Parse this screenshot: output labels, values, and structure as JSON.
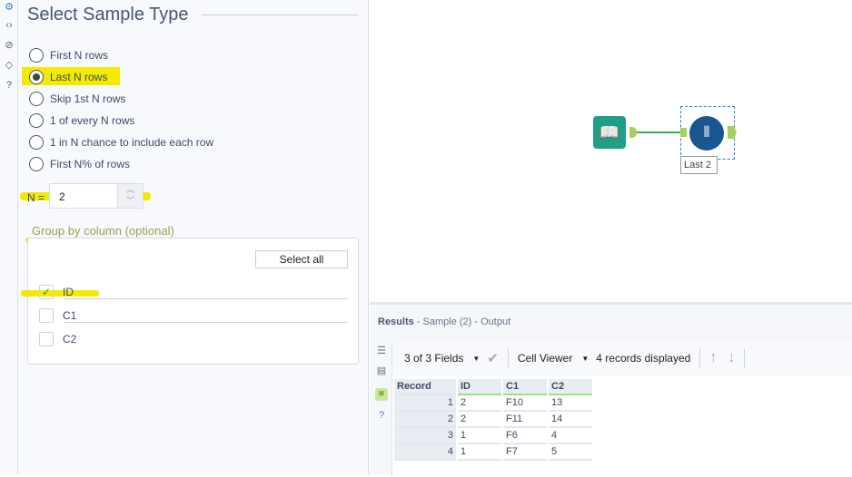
{
  "config": {
    "title": "Select Sample Type",
    "options": [
      {
        "label": "First N rows",
        "selected": false
      },
      {
        "label": "Last N rows",
        "selected": true
      },
      {
        "label": "Skip 1st N rows",
        "selected": false
      },
      {
        "label": "1 of every N rows",
        "selected": false
      },
      {
        "label": "1 in N chance to include each row",
        "selected": false
      },
      {
        "label": "First N% of rows",
        "selected": false
      }
    ],
    "n_label": "N =",
    "n_value": "2",
    "group_label": "Group by column (optional)",
    "select_all": "Select all",
    "columns": [
      {
        "name": "ID",
        "checked": true
      },
      {
        "name": "C1",
        "checked": false
      },
      {
        "name": "C2",
        "checked": false
      }
    ]
  },
  "canvas": {
    "tool_label": "Last 2"
  },
  "results": {
    "title": "Results",
    "subtitle": " - Sample (2) - Output",
    "fields": "3 of 3 Fields",
    "viewer": "Cell Viewer",
    "records": "4 records displayed",
    "headers": [
      "Record",
      "ID",
      "C1",
      "C2"
    ],
    "rows": [
      [
        "1",
        "2",
        "F10",
        "13"
      ],
      [
        "2",
        "2",
        "F11",
        "14"
      ],
      [
        "3",
        "1",
        "F6",
        "4"
      ],
      [
        "4",
        "1",
        "F7",
        "5"
      ]
    ]
  }
}
